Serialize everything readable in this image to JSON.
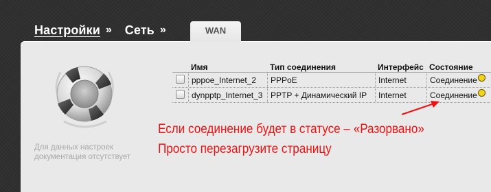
{
  "breadcrumb": {
    "items": [
      "Настройки",
      "Сеть"
    ],
    "separator": "»"
  },
  "tab": {
    "label": "WAN"
  },
  "help": {
    "text": "Для данных настроек документация отсутствует"
  },
  "table": {
    "headers": [
      "Имя",
      "Тип соединения",
      "Интерфейс",
      "Состояние"
    ],
    "rows": [
      {
        "name": "pppoe_Internet_2",
        "type": "PPPoE",
        "interface": "Internet",
        "status": "Соединение"
      },
      {
        "name": "dynpptp_Internet_3",
        "type": "PPTP + Динамический IP",
        "interface": "Internet",
        "status": "Соединение"
      }
    ]
  },
  "annotation": {
    "line1": "Если соединение будет в статусе – «Разорвано»",
    "line2": "Просто перезагрузите страницу",
    "color": "#ee1111"
  },
  "colors": {
    "background": "#303030",
    "panel": "#e9e9e9",
    "status_indicator": "#f2d21a"
  }
}
